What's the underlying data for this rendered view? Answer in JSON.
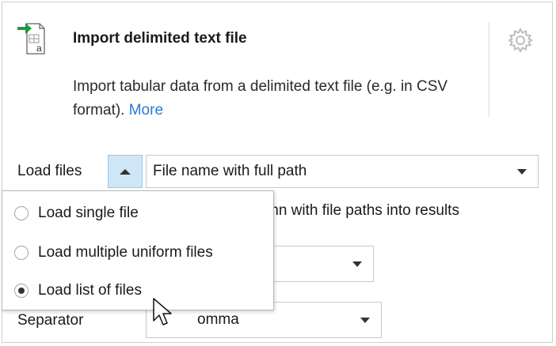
{
  "header": {
    "title": "Import delimited text file",
    "description": "Import tabular data from a delimited text file (e.g. in CSV format).",
    "more_link": "More",
    "icons": {
      "import": "import-file-icon",
      "settings": "gear-icon"
    }
  },
  "load_files": {
    "label": "Load files",
    "toggle_icon": "chevron-up-icon",
    "selected_value": "File name with full path",
    "options": [
      {
        "label": "Load single file",
        "checked": false
      },
      {
        "label": "Load multiple uniform files",
        "checked": false
      },
      {
        "label": "Load list of files",
        "checked": true
      }
    ]
  },
  "column_option_text": "mn with file paths into results",
  "separator": {
    "label": "Separator",
    "value": "omma"
  },
  "colors": {
    "accent": "#2a7bd7",
    "toggle_bg": "#cfe6f7",
    "import_arrow": "#1e9c3c"
  }
}
